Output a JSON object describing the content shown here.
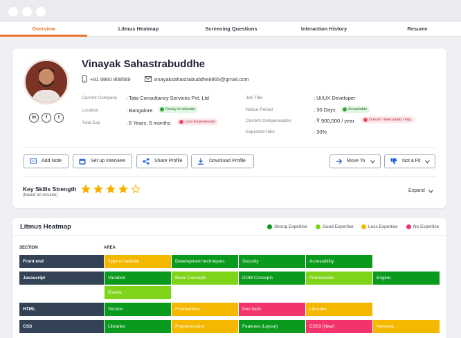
{
  "tabs": [
    "Overview",
    "Litmus Heatmap",
    "Screening Questions",
    "Interaction History",
    "Resume"
  ],
  "profile": {
    "name": "Vinayak Sahastrabuddhe",
    "phone": "+91 9860 808569",
    "email": "vinayaksahastrabuddhe8865@gmail.com",
    "social": [
      "in",
      "f",
      "t"
    ],
    "fields_left": [
      {
        "label": "Current Company",
        "value": ": Tata Consultancy Services Pvt. Ltd",
        "badge": ""
      },
      {
        "label": "Location",
        "value": ": Bangalore",
        "badge": "Ready to relocate"
      },
      {
        "label": "Total Exp",
        "value": ": 6 Years, 5 months",
        "badge": "Less Experienced"
      }
    ],
    "fields_right": [
      {
        "label": "Job Title",
        "value": ": UI/UX Developer",
        "badge": ""
      },
      {
        "label": "Notice Period",
        "value": ": 30 Days",
        "badge": "Acceptable"
      },
      {
        "label": "Current Compensation",
        "value": ": ₹ 900,000 / year",
        "badge": "Doesn't meet salary reqs."
      },
      {
        "label": "Expected Hike",
        "value": ": 30%",
        "badge": ""
      }
    ]
  },
  "actions": {
    "add_note": "Add Note",
    "setup_interview": "Set up Interview",
    "share_profile": "Share Profile",
    "download_profile": "Download Profile",
    "move_to": "Move To",
    "not_a_fit": "Not a Fit"
  },
  "skills": {
    "title": "Key Skills Strength",
    "subtitle": "(based on resume)",
    "rating": 4,
    "max": 5,
    "expand": "Expand"
  },
  "heatmap": {
    "title": "Litmus Heatmap",
    "legend": [
      {
        "label": "Strong Expertise",
        "color": "#0a9a1e"
      },
      {
        "label": "Good Expertise",
        "color": "#7fd318"
      },
      {
        "label": "Less Expertise",
        "color": "#f4b800"
      },
      {
        "label": "No Expertise",
        "color": "#f2346a"
      }
    ],
    "col_section": "SECTION",
    "col_area": "AREA",
    "rows": [
      {
        "section": "Front end",
        "areas": [
          {
            "name": "Type of website",
            "level": "less"
          },
          {
            "name": "Development techniques",
            "level": "strong"
          },
          {
            "name": "Security",
            "level": "strong"
          },
          {
            "name": "Accessibility",
            "level": "strong"
          }
        ]
      },
      {
        "section": "Javascript",
        "areas": [
          {
            "name": "Variation",
            "level": "strong"
          },
          {
            "name": "Basic Concepts",
            "level": "good"
          },
          {
            "name": "DOM Concepts",
            "level": "strong"
          },
          {
            "name": "Frameworks",
            "level": "good"
          },
          {
            "name": "Engine",
            "level": "strong"
          },
          {
            "name": "Events",
            "level": "good"
          }
        ]
      },
      {
        "section": "HTML",
        "areas": [
          {
            "name": "Version",
            "level": "strong"
          },
          {
            "name": "Frameworks",
            "level": "less"
          },
          {
            "name": "Dev tools",
            "level": "no"
          },
          {
            "name": "Libraries",
            "level": "less"
          }
        ]
      },
      {
        "section": "CSS",
        "areas": [
          {
            "name": "Libraries",
            "level": "strong"
          },
          {
            "name": "Preprocessors",
            "level": "less"
          },
          {
            "name": "Features (Layout)",
            "level": "strong"
          },
          {
            "name": "CSS3 (New)",
            "level": "no"
          },
          {
            "name": "Versions",
            "level": "less"
          }
        ]
      }
    ]
  }
}
